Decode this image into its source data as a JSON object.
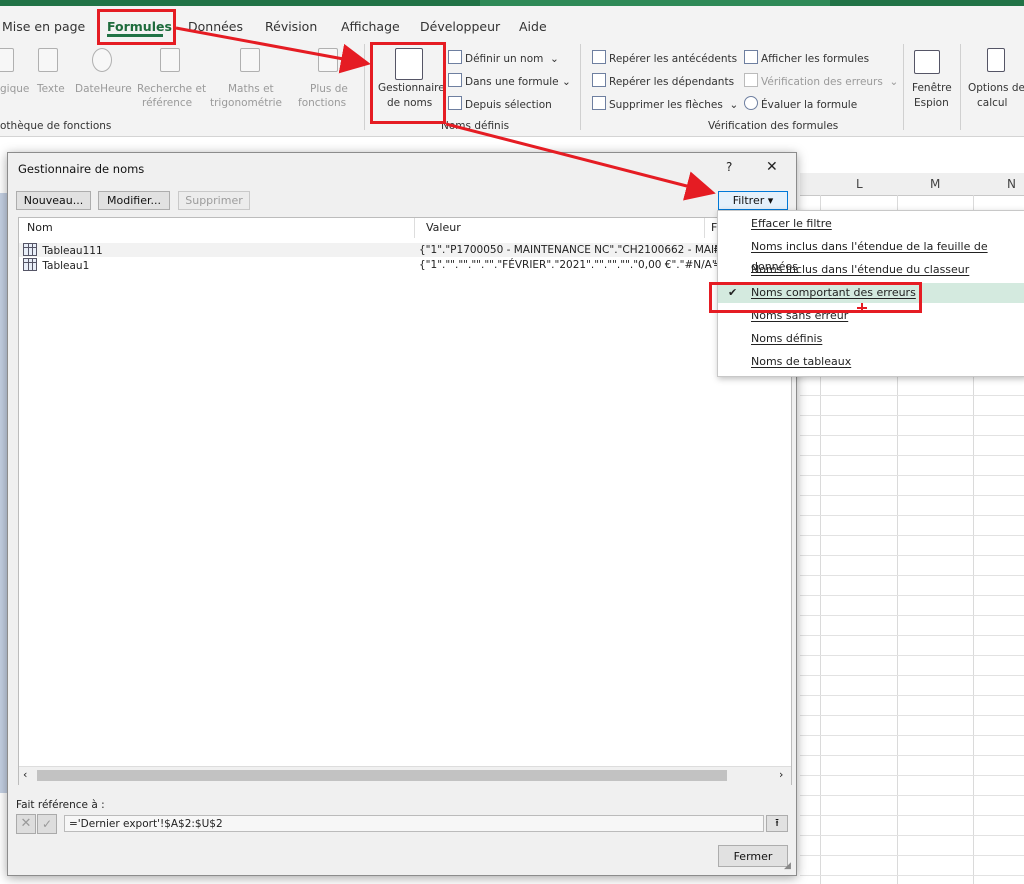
{
  "ribbon_tabs": [
    "Mise en page",
    "Formules",
    "Données",
    "Révision",
    "Affichage",
    "Développeur",
    "Aide"
  ],
  "ribbon_groups": {
    "library": {
      "label": "othèque de fonctions",
      "items": [
        "gique",
        "Texte",
        "DateHeure",
        "Recherche et",
        "référence",
        "Maths et",
        "trigonométrie",
        "Plus de",
        "fonctions"
      ]
    },
    "defined_names": {
      "label": "Noms définis",
      "manager": [
        "Gestionnaire",
        "de noms"
      ],
      "define": "Définir un nom",
      "in_formula": "Dans une formule",
      "from_selection": "Depuis sélection"
    },
    "audit": {
      "label": "Vérification des formules",
      "precedents": "Repérer les antécédents",
      "dependents": "Repérer les dépendants",
      "remove_arrows": "Supprimer les flèches",
      "show_formulas": "Afficher les formules",
      "error_check": "Vérification des erreurs",
      "evaluate": "Évaluer la formule",
      "watch": [
        "Fenêtre",
        "Espion"
      ],
      "calc_options": [
        "Options de",
        "calcul"
      ]
    }
  },
  "sheet": {
    "columns": [
      "L",
      "M",
      "N"
    ]
  },
  "dialog": {
    "title": "Gestionnaire de noms",
    "help": "?",
    "close": "✕",
    "buttons": {
      "new": "Nouveau...",
      "edit": "Modifier...",
      "delete": "Supprimer",
      "filter": "Filtrer ▾"
    },
    "list_headers": [
      "Nom",
      "Valeur",
      "F"
    ],
    "rows": [
      {
        "name": "Tableau111",
        "value": "{\"1\".\"P1700050 - MAINTENANCE NC\".\"CH2100662 - MAINT...",
        "ref": "="
      },
      {
        "name": "Tableau1",
        "value": "{\"1\".\"\".\"\".\"\".\"\".\"FÉVRIER\".\"2021\".\"\".\"\".\"\".\"0,00 €\".\"#N/A\".\" #N...",
        "ref": "="
      }
    ],
    "refers_label": "Fait référence à :",
    "refers_value": "='Dernier export'!$A$2:$U$2",
    "close_button": "Fermer"
  },
  "filter_menu": [
    {
      "label": "Effacer le filtre",
      "checked": false
    },
    {
      "label": "Noms inclus dans l'étendue de la feuille de données",
      "checked": false
    },
    {
      "label": "Noms inclus dans l'étendue du classeur",
      "checked": false
    },
    {
      "label": "Noms comportant des erreurs",
      "checked": true
    },
    {
      "label": "Noms sans erreur",
      "checked": false
    },
    {
      "label": "Noms définis",
      "checked": false
    },
    {
      "label": "Noms de tableaux",
      "checked": false
    }
  ],
  "colors": {
    "accent": "#217346",
    "annotation": "#e51c23",
    "selection": "#d4eadf"
  }
}
